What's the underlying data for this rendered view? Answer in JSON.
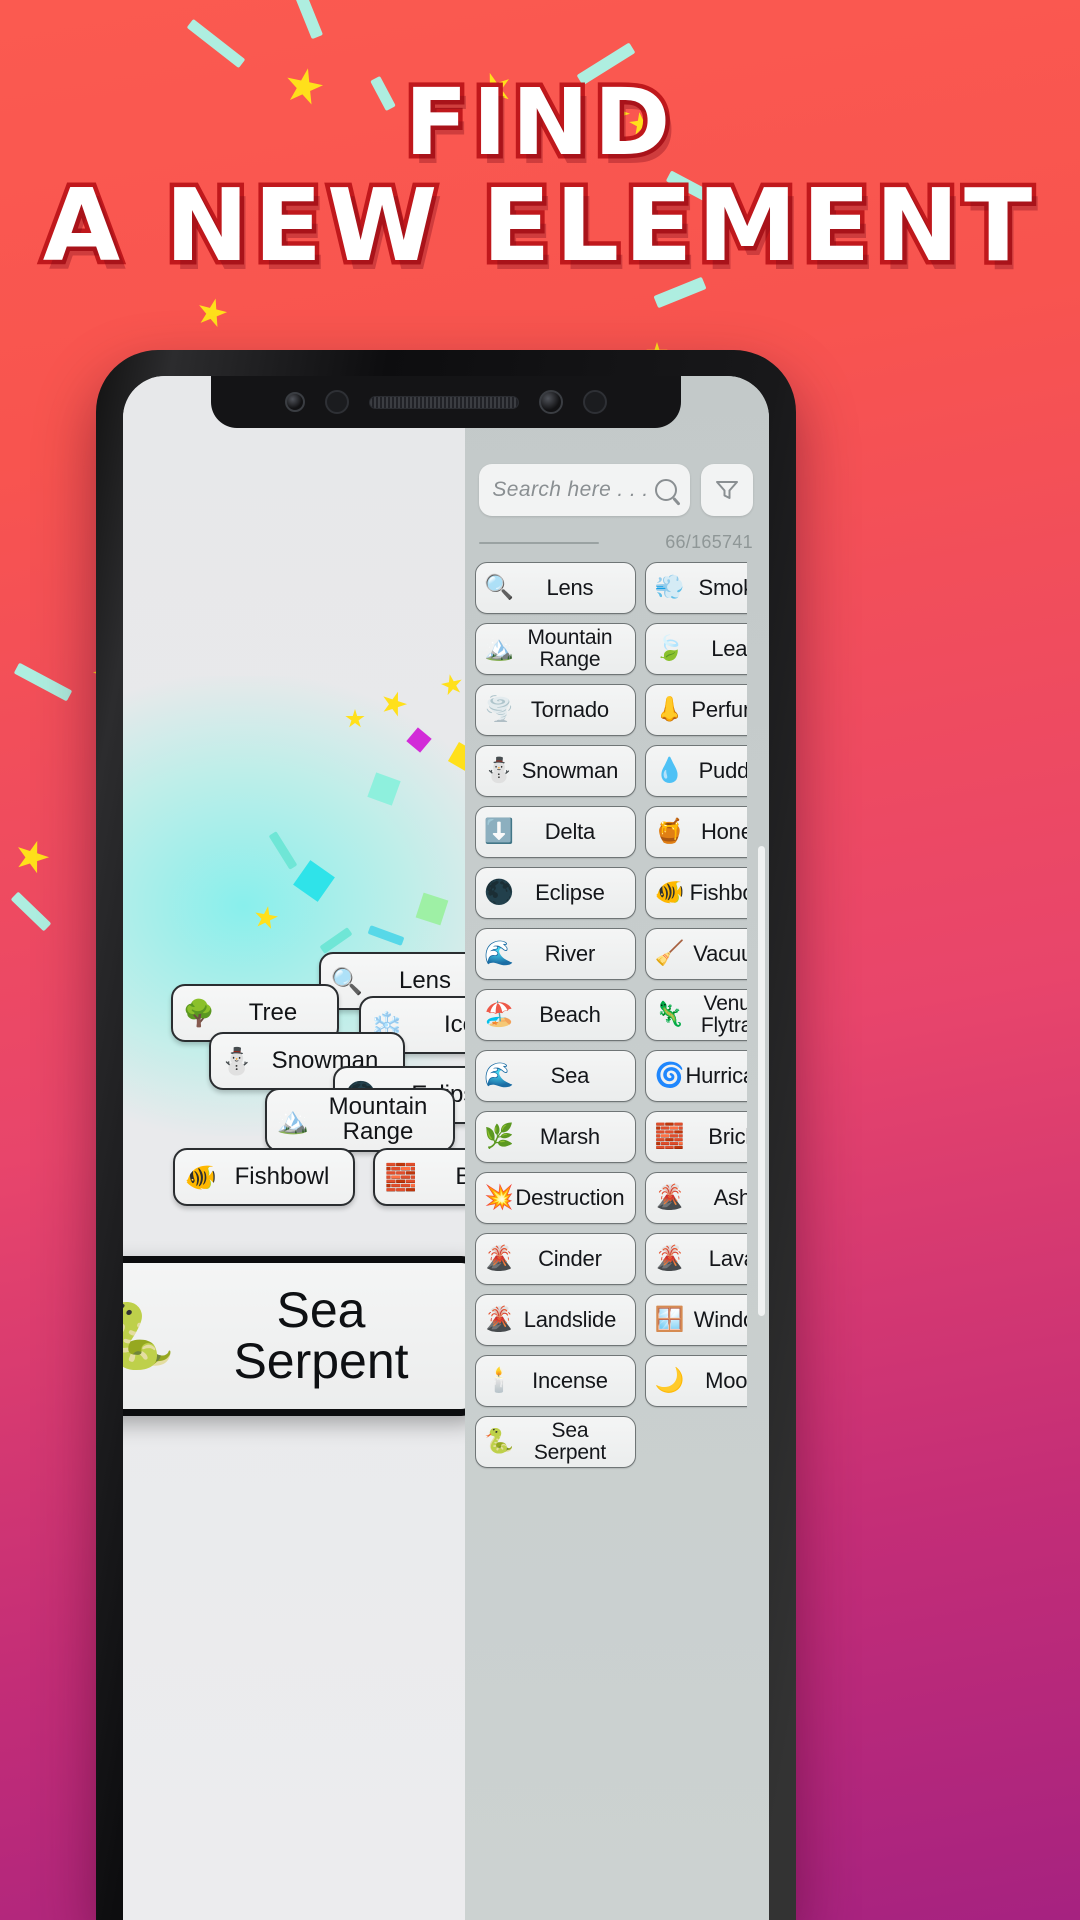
{
  "promo": {
    "headline_line1": "FIND",
    "headline_line2": "A NEW ELEMENT",
    "bg_color_top": "#fb5a50",
    "bg_color_bottom": "#a62280",
    "headline_fill": "#ffffff",
    "headline_outline": "#c0181c",
    "star_color": "#ffe01b",
    "streak_color": "#aeeee0"
  },
  "app": {
    "search": {
      "placeholder": "Search here . . .",
      "value": "",
      "search_icon": "magnifier-icon",
      "filter_icon": "funnel-icon"
    },
    "counter": "66/165741",
    "featured": {
      "emoji": "🐍",
      "label_line1": "Sea",
      "label_line2": "Serpent",
      "icon_name": "snake-icon"
    },
    "canvas_items": [
      {
        "emoji": "🔍",
        "label": "Lens",
        "icon_name": "magnifier-icon"
      },
      {
        "emoji": "🌳",
        "label": "Tree",
        "icon_name": "tree-icon"
      },
      {
        "emoji": "❄️",
        "label": "Ice",
        "icon_name": "snowflake-icon"
      },
      {
        "emoji": "⛄",
        "label": "Snowman",
        "icon_name": "snowman-icon"
      },
      {
        "emoji": "🌑",
        "label": "Eclipse",
        "icon_name": "new-moon-icon"
      },
      {
        "emoji": "🏔️",
        "label": "Mountain Range",
        "icon_name": "mountain-icon"
      },
      {
        "emoji": "🐠",
        "label": "Fishbowl",
        "icon_name": "tropical-fish-icon"
      },
      {
        "emoji": "🧱",
        "label": "Brick",
        "icon_name": "brick-icon"
      }
    ],
    "list_items": [
      {
        "emoji": "🔍",
        "label": "Lens",
        "icon_name": "magnifier-icon"
      },
      {
        "emoji": "💨",
        "label": "Smoke",
        "icon_name": "dash-icon"
      },
      {
        "emoji": "🏔️",
        "label": "Mountain Range",
        "icon_name": "mountain-icon"
      },
      {
        "emoji": "🍃",
        "label": "Leaf",
        "icon_name": "leaf-icon"
      },
      {
        "emoji": "🌪️",
        "label": "Tornado",
        "icon_name": "tornado-icon"
      },
      {
        "emoji": "👃",
        "label": "Perfume",
        "icon_name": "nose-icon"
      },
      {
        "emoji": "⛄",
        "label": "Snowman",
        "icon_name": "snowman-icon"
      },
      {
        "emoji": "💧",
        "label": "Puddle",
        "icon_name": "droplet-icon"
      },
      {
        "emoji": "⬇️",
        "label": "Delta",
        "icon_name": "down-arrow-icon"
      },
      {
        "emoji": "🍯",
        "label": "Honey",
        "icon_name": "honey-pot-icon"
      },
      {
        "emoji": "🌑",
        "label": "Eclipse",
        "icon_name": "new-moon-icon"
      },
      {
        "emoji": "🐠",
        "label": "Fishbowl",
        "icon_name": "tropical-fish-icon"
      },
      {
        "emoji": "🌊",
        "label": "River",
        "icon_name": "wave-icon"
      },
      {
        "emoji": "🧹",
        "label": "Vacuum",
        "icon_name": "broom-icon"
      },
      {
        "emoji": "🏖️",
        "label": "Beach",
        "icon_name": "beach-icon"
      },
      {
        "emoji": "🦎",
        "label": "Venus Flytrap",
        "icon_name": "lizard-icon"
      },
      {
        "emoji": "🌊",
        "label": "Sea",
        "icon_name": "wave-icon"
      },
      {
        "emoji": "🌀",
        "label": "Hurricane",
        "icon_name": "cyclone-icon"
      },
      {
        "emoji": "🌿",
        "label": "Marsh",
        "icon_name": "herb-icon"
      },
      {
        "emoji": "🧱",
        "label": "Brick",
        "icon_name": "brick-icon"
      },
      {
        "emoji": "💥",
        "label": "Destruction",
        "icon_name": "collision-icon"
      },
      {
        "emoji": "🌋",
        "label": "Ash",
        "icon_name": "volcano-icon"
      },
      {
        "emoji": "🌋",
        "label": "Cinder",
        "icon_name": "volcano-icon"
      },
      {
        "emoji": "🌋",
        "label": "Lava",
        "icon_name": "volcano-icon"
      },
      {
        "emoji": "🌋",
        "label": "Landslide",
        "icon_name": "volcano-icon"
      },
      {
        "emoji": "🪟",
        "label": "Window",
        "icon_name": "window-icon"
      },
      {
        "emoji": "🕯️",
        "label": "Incense",
        "icon_name": "candle-icon"
      },
      {
        "emoji": "🌙",
        "label": "Moon",
        "icon_name": "crescent-moon-icon"
      },
      {
        "emoji": "🐍",
        "label": "Sea Serpent",
        "icon_name": "snake-icon"
      }
    ]
  }
}
